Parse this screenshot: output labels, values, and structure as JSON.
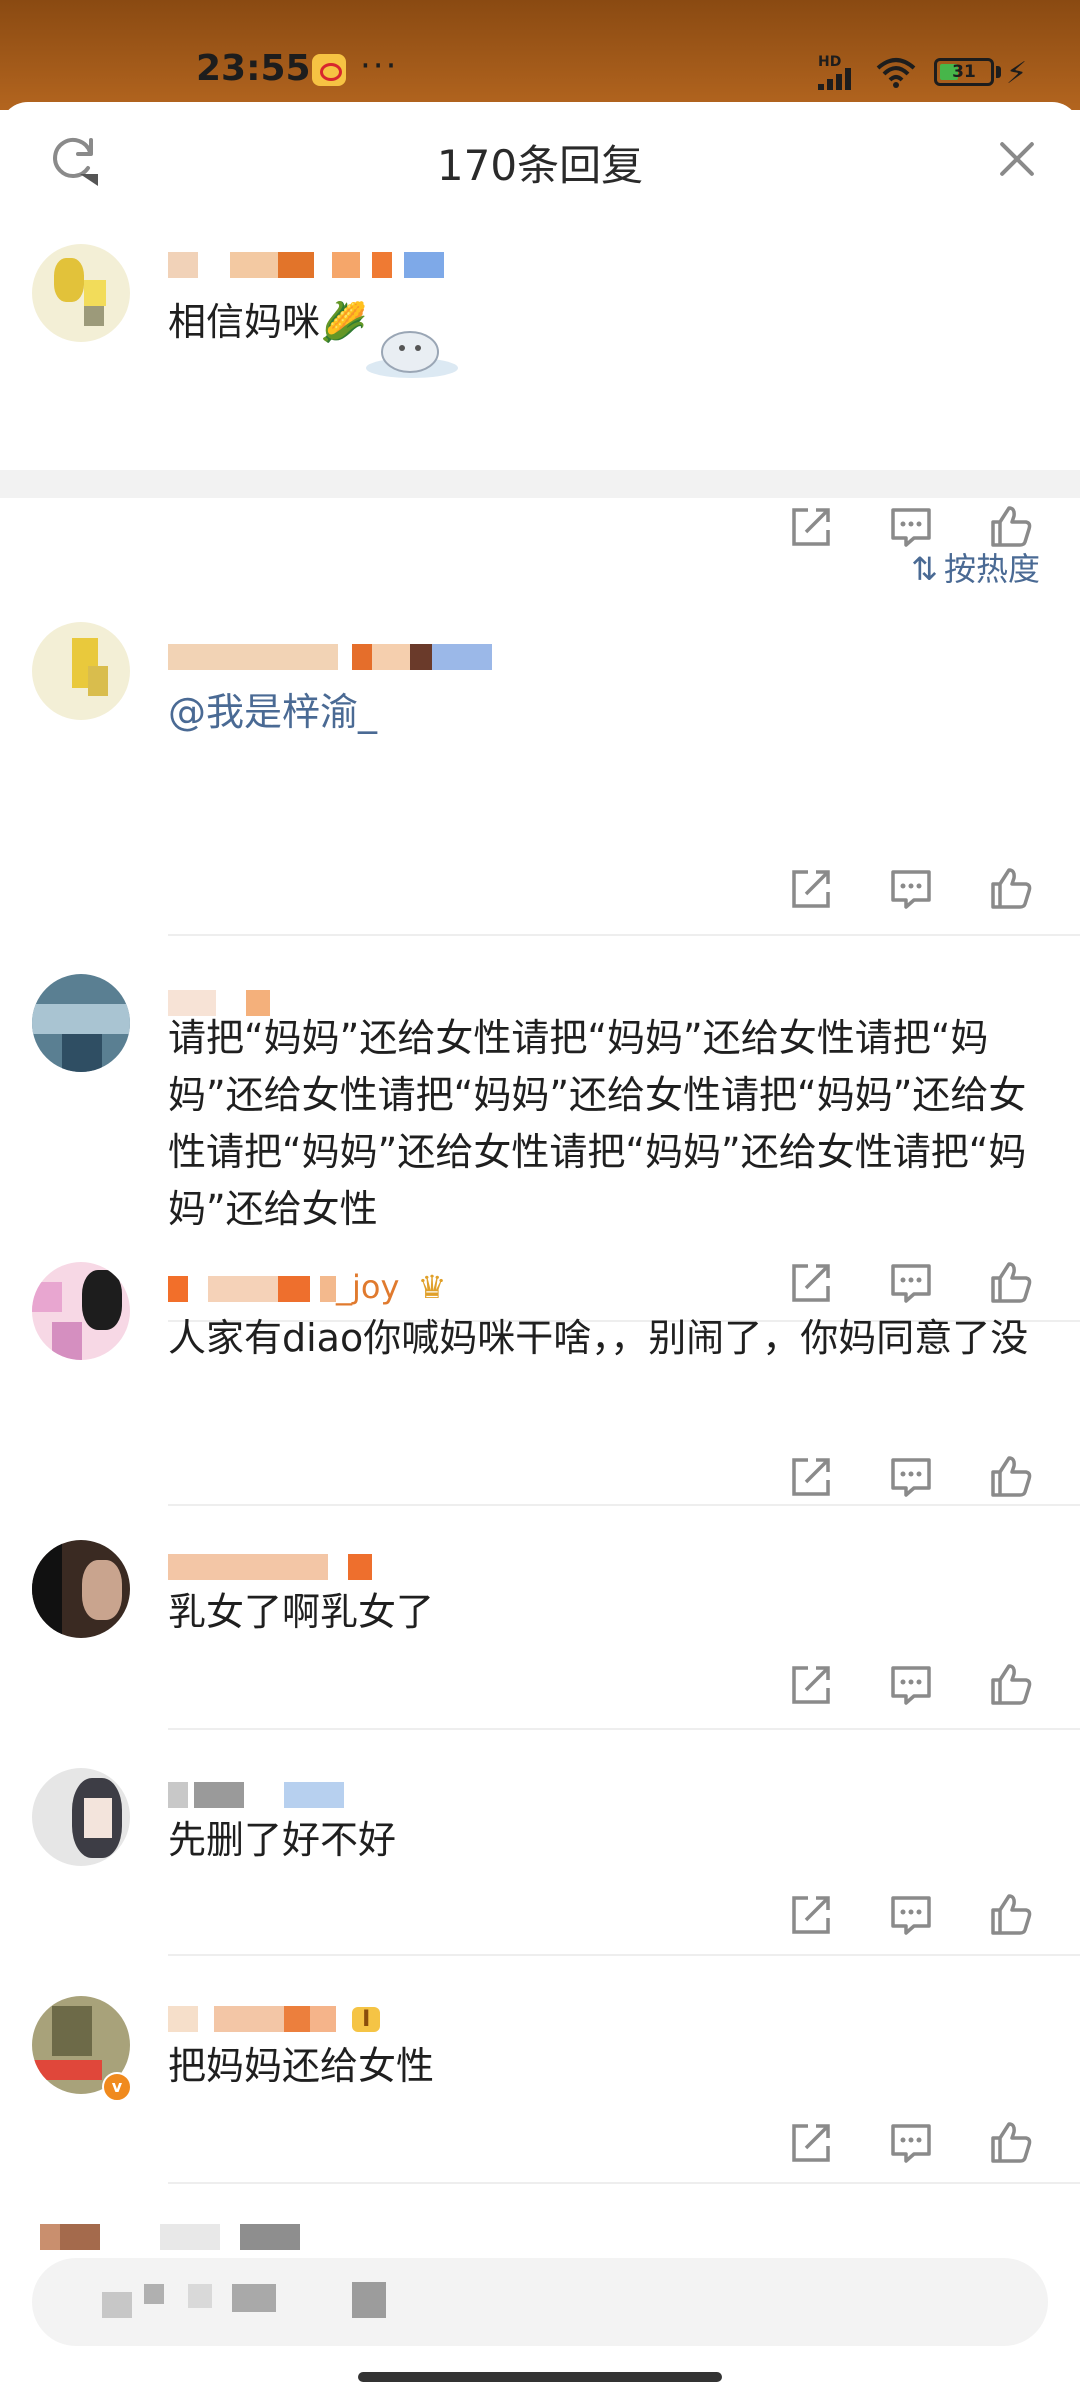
{
  "status": {
    "time": "23:55",
    "dots": "···",
    "hd": "HD",
    "battery": "31"
  },
  "header": {
    "title": "170条回复"
  },
  "root_comment": {
    "text": "相信妈咪🌽"
  },
  "sort": {
    "label": "按热度"
  },
  "comments": [
    {
      "name_suffix": "",
      "mention": "@我是梓渝_"
    },
    {
      "text": "请把“妈妈”还给女性请把“妈妈”还给女性请把“妈妈”还给女性请把“妈妈”还给女性请把“妈妈”还给女性请把“妈妈”还给女性请把“妈妈”还给女性请把“妈妈”还给女性"
    },
    {
      "name_suffix": "_joy",
      "text": "人家有diao你喊妈咪干啥，，别闹了，你妈同意了没"
    },
    {
      "text": "乳女了啊乳女了"
    },
    {
      "text": "先删了好不好"
    },
    {
      "badge": "I",
      "text": "把妈妈还给女性"
    }
  ],
  "colors": {
    "accent_link": "#4a6a94",
    "username": "#e07a2e",
    "statusbar": "#a35a1a"
  }
}
